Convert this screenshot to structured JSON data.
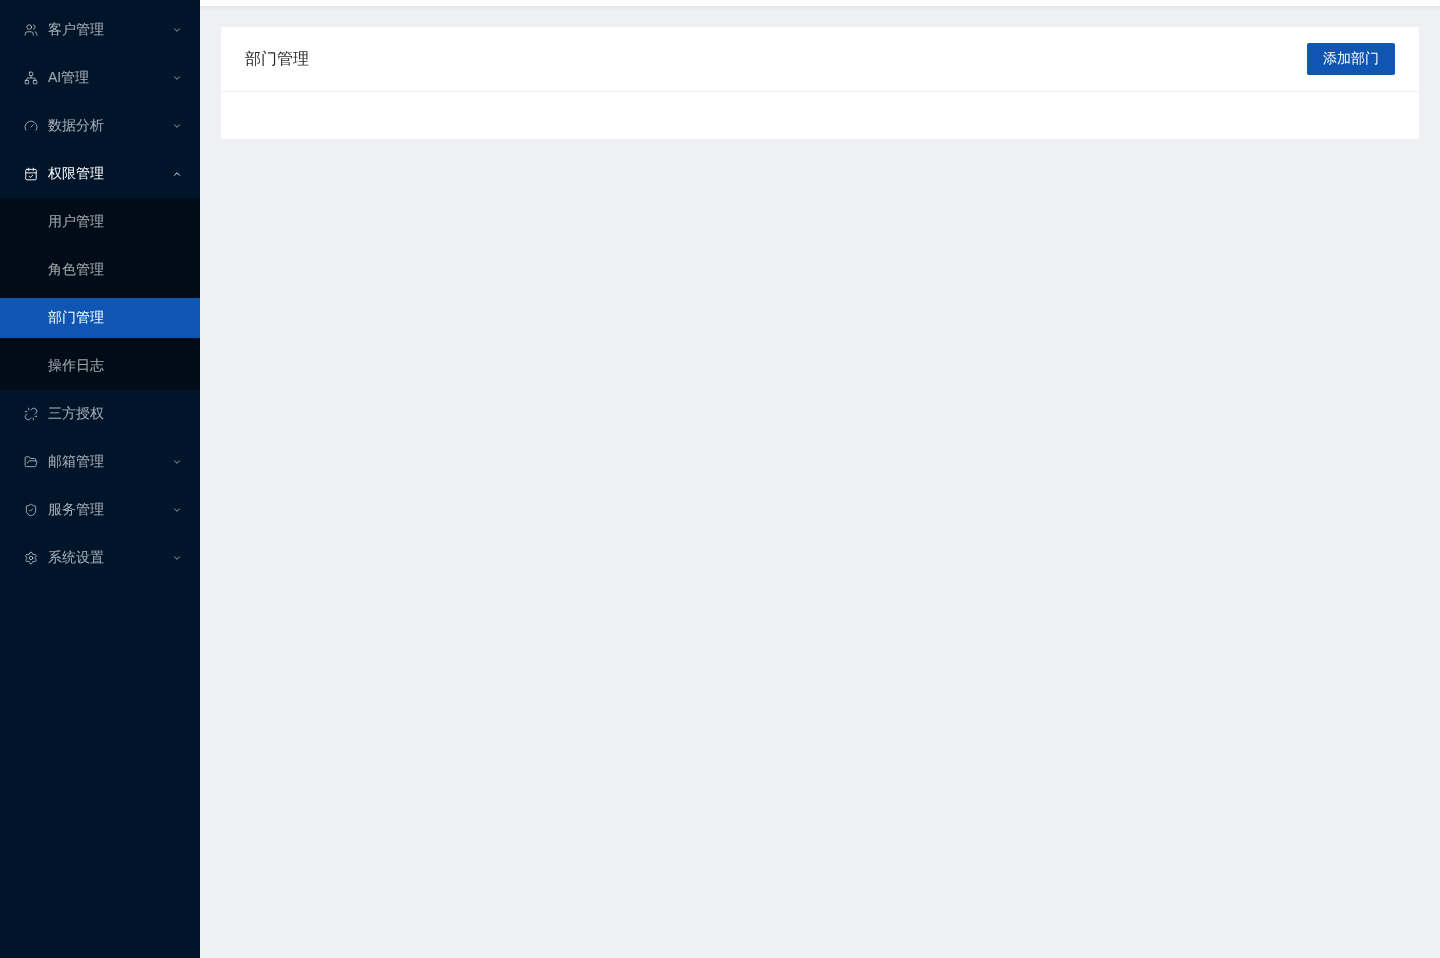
{
  "sidebar": {
    "items": [
      {
        "kind": "submenu",
        "label": "客户管理",
        "selected": false,
        "expanded": false
      },
      {
        "kind": "submenu",
        "label": "AI管理",
        "selected": false,
        "expanded": false
      },
      {
        "kind": "submenu",
        "label": "数据分析",
        "selected": false,
        "expanded": false
      },
      {
        "kind": "submenu",
        "label": "权限管理",
        "selected": false,
        "expanded": true,
        "children": [
          {
            "label": "用户管理",
            "selected": false
          },
          {
            "label": "角色管理",
            "selected": false
          },
          {
            "label": "部门管理",
            "selected": true
          },
          {
            "label": "操作日志",
            "selected": false
          }
        ]
      },
      {
        "kind": "link",
        "label": "三方授权",
        "selected": false
      },
      {
        "kind": "submenu",
        "label": "邮箱管理",
        "selected": false,
        "expanded": false
      },
      {
        "kind": "submenu",
        "label": "服务管理",
        "selected": false,
        "expanded": false
      },
      {
        "kind": "submenu",
        "label": "系统设置",
        "selected": false,
        "expanded": false
      }
    ]
  },
  "page": {
    "title": "部门管理",
    "add_button": "添加部门"
  }
}
